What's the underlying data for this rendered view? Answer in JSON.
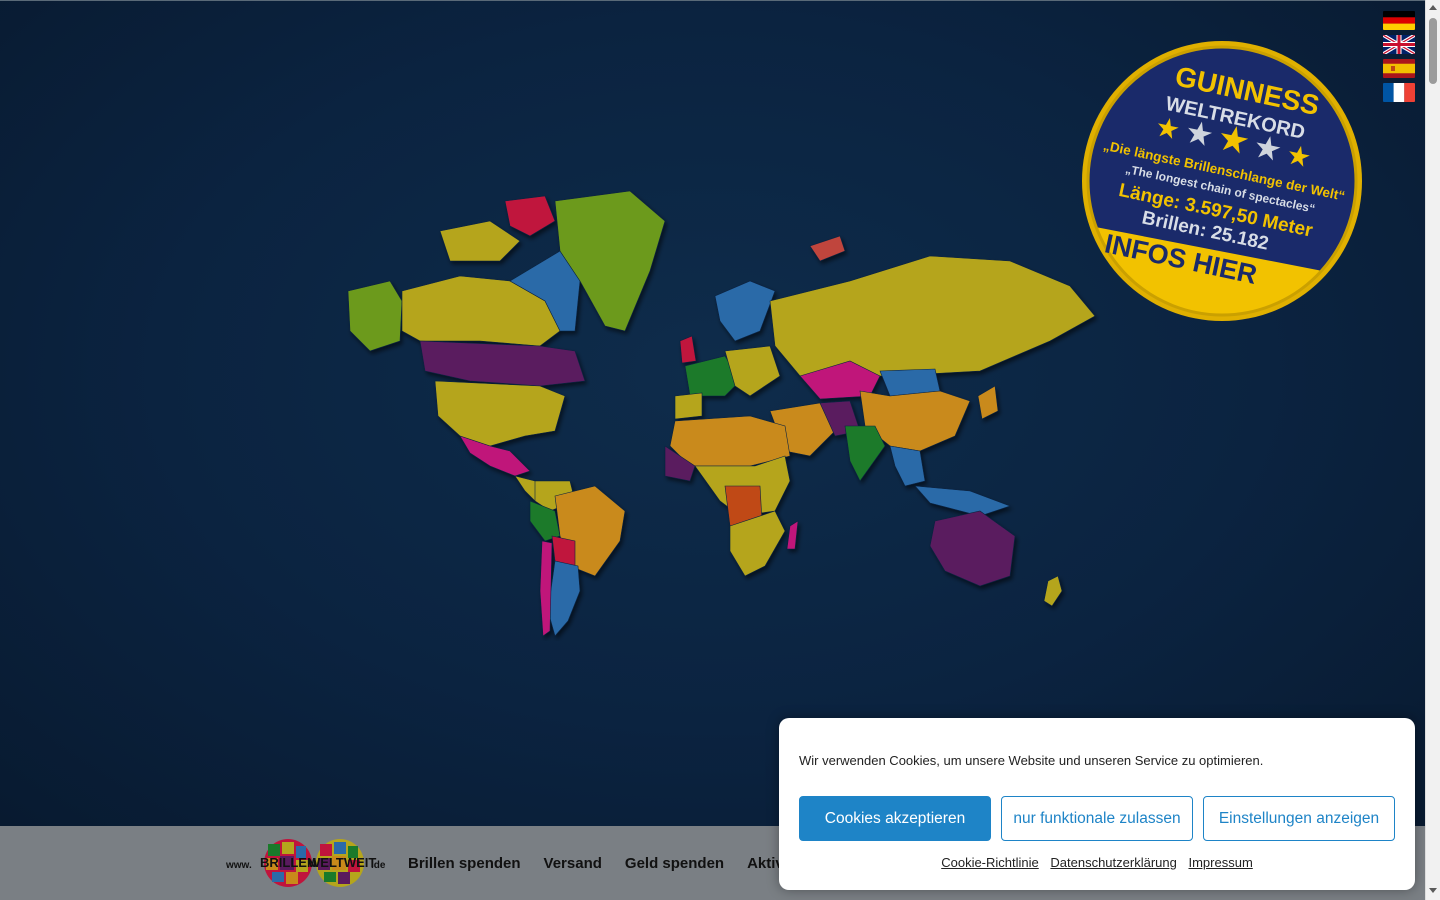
{
  "badge": {
    "title": "GUINNESS",
    "subtitle": "WELTREKORD",
    "quote_de": "„Die längste Brillenschlange der Welt“",
    "quote_en": "„The longest chain of spectacles“",
    "length": "Länge: 3.597,50 Meter",
    "glasses": "Brillen: 25.182",
    "cta": "INFOS HIER"
  },
  "flags": [
    "german-flag",
    "uk-flag",
    "spanish-flag",
    "french-flag"
  ],
  "logo": {
    "prefix": "www.",
    "word1": "BRILLEN",
    "word2": "WELTWEIT",
    "suffix": ".de"
  },
  "nav": {
    "items": [
      "Brillen spenden",
      "Versand",
      "Geld spenden",
      "Aktiv mi"
    ]
  },
  "cookie": {
    "text": "Wir verwenden Cookies, um unsere Website und unseren Service zu optimieren.",
    "accept": "Cookies akzeptieren",
    "functional": "nur funktionale zulassen",
    "settings": "Einstellungen anzeigen",
    "links": [
      "Cookie-Richtlinie",
      "Datenschutzerklärung",
      "Impressum"
    ]
  },
  "colors": {
    "accent": "#1e84c7",
    "badge_yellow": "#f2c200",
    "badge_navy": "#1a2a6a"
  }
}
